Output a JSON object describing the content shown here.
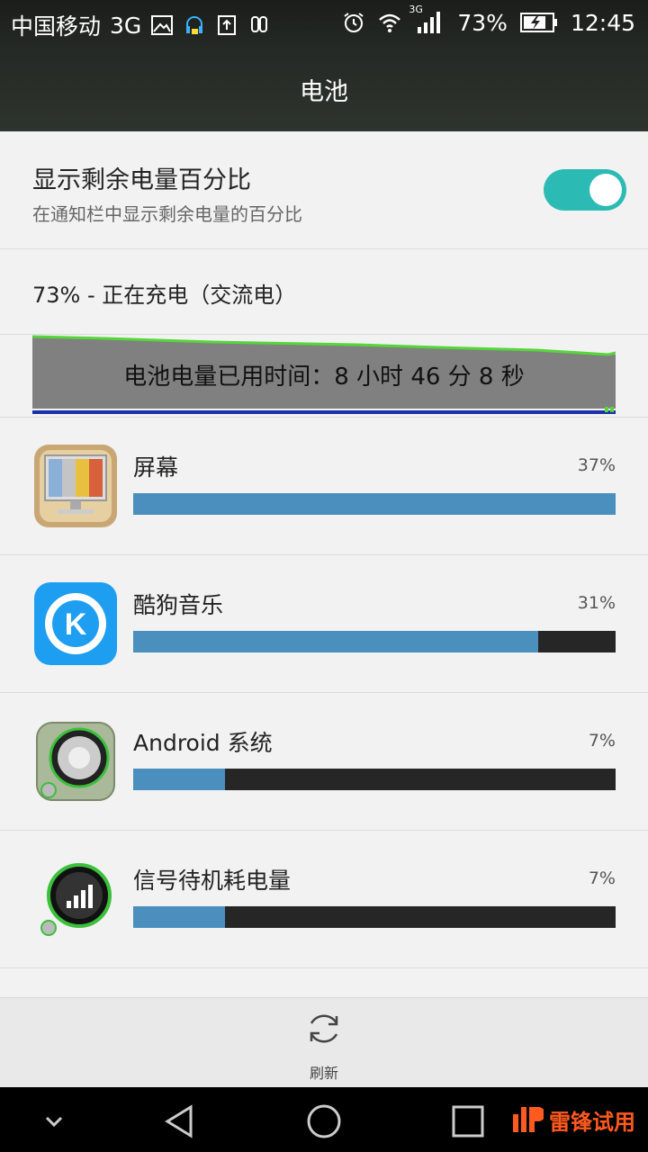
{
  "status_bar": {
    "carrier": "中国移动",
    "network": "3G",
    "signal_badge": "3G",
    "battery": "73%",
    "time": "12:45",
    "icons": [
      "gallery-icon",
      "headset-icon",
      "upload-icon",
      "sim-icon",
      "alarm-icon",
      "wifi-icon",
      "signal-icon",
      "battery-charging-icon"
    ]
  },
  "header": {
    "title": "电池"
  },
  "setting": {
    "title": "显示剩余电量百分比",
    "subtitle": "在通知栏中显示剩余电量的百分比",
    "enabled": true,
    "accent": "#2bbbb4"
  },
  "charge_status": "73% - 正在充电（交流电）",
  "graph": {
    "usage_text": "电池电量已用时间：8 小时 46 分 8 秒",
    "line_color": "#56d63a"
  },
  "apps": [
    {
      "name": "屏幕",
      "percent": "37%",
      "fill": 1.0,
      "icon": "display-icon"
    },
    {
      "name": "酷狗音乐",
      "percent": "31%",
      "fill": 0.84,
      "icon": "kugou-icon"
    },
    {
      "name": "Android 系统",
      "percent": "7%",
      "fill": 0.19,
      "icon": "android-system-icon"
    },
    {
      "name": "信号待机耗电量",
      "percent": "7%",
      "fill": 0.19,
      "icon": "cell-standby-icon"
    }
  ],
  "bar_color": "#4a8fbe",
  "refresh": {
    "label": "刷新"
  },
  "watermark": "雷锋试用"
}
